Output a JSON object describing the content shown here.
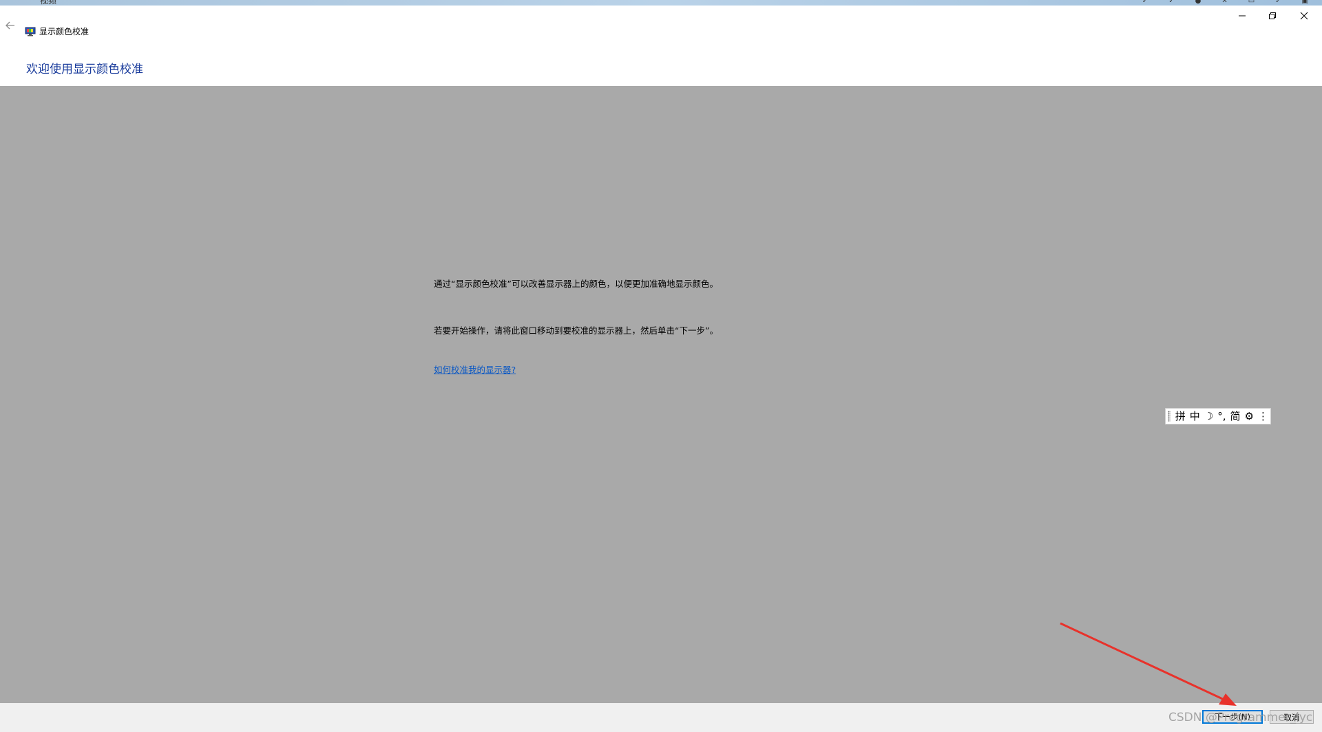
{
  "top_strip": {
    "text": "视频"
  },
  "window": {
    "title": "显示颜色校准",
    "icons": {
      "back": "back-arrow-icon",
      "app": "monitor-calibration-icon",
      "minimize": "minimize-icon",
      "restore": "restore-icon",
      "close": "close-icon"
    }
  },
  "header": {
    "title": "欢迎使用显示颜色校准"
  },
  "main": {
    "paragraph1": "通过“显示颜色校准”可以改善显示器上的颜色，以便更加准确地显示颜色。",
    "paragraph2": "若要开始操作，请将此窗口移动到要校准的显示器上，然后单击“下一步”。",
    "help_link": "如何校准我的显示器?"
  },
  "ime_toolbar": {
    "items": [
      "拼",
      "中",
      "☽",
      "°,",
      "简",
      "⚙",
      "⋮"
    ]
  },
  "footer": {
    "next_label": "下一步(N)",
    "cancel_label": "取消"
  },
  "watermark": {
    "text": "CSDN @Programmer_lyc"
  },
  "colors": {
    "header_title": "#1a3c9c",
    "main_bg": "#a9a9a9",
    "link": "#0b58c4",
    "annotation_arrow": "#e8322b"
  }
}
